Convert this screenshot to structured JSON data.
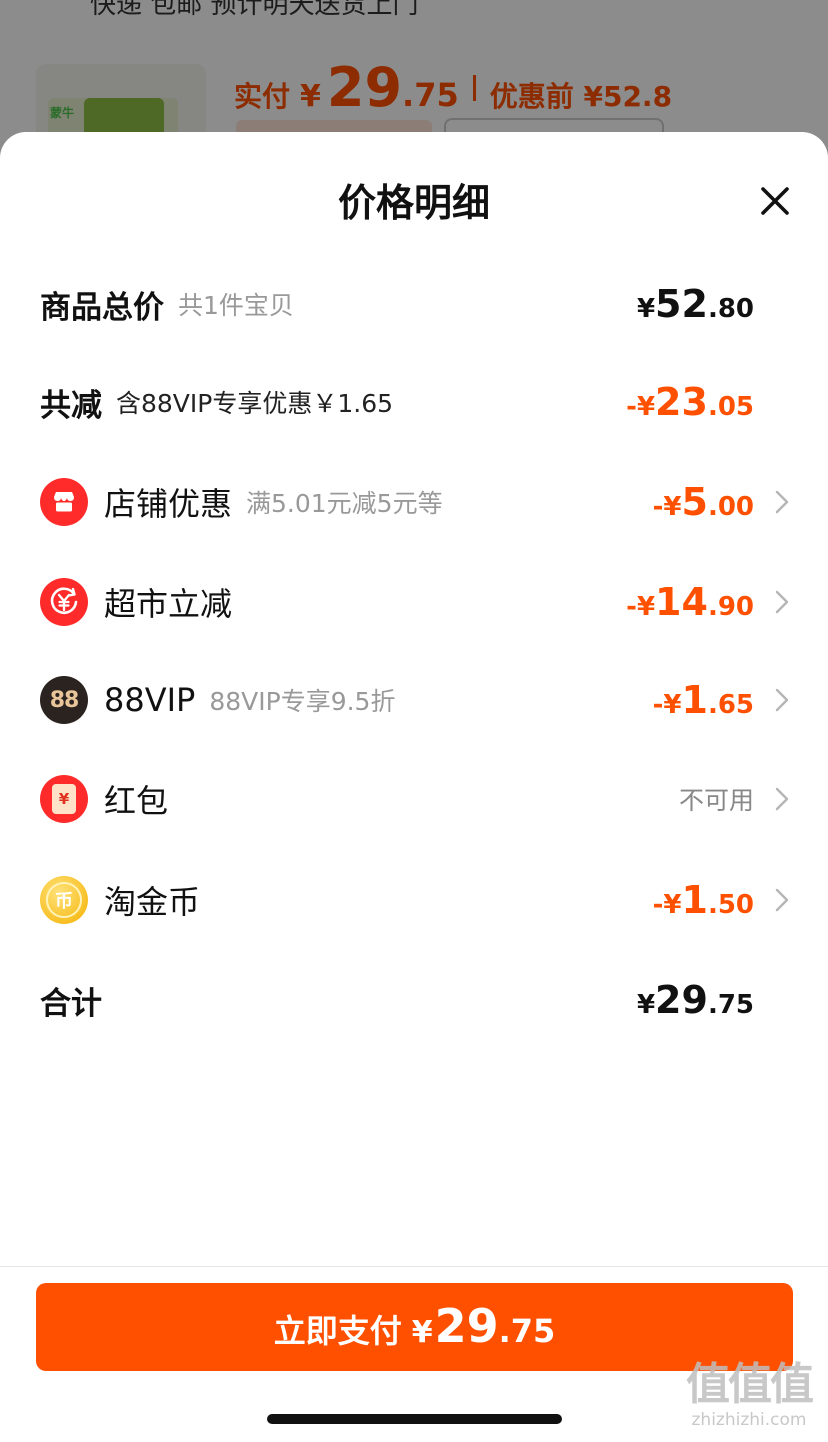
{
  "background": {
    "shipping_text": "快递 包邮 预计明天送货上门",
    "shipping_link": "送货上门",
    "product_brand": "蒙牛",
    "paid_label": "实付",
    "paid_currency": "¥",
    "paid_int": "29",
    "paid_dec": ".75",
    "original_price": "优惠前 ¥52.8"
  },
  "sheet": {
    "title": "价格明细",
    "close_icon": "close-icon"
  },
  "rows": {
    "total": {
      "label": "商品总价",
      "sub": "共1件宝贝",
      "currency": "¥",
      "int": "52",
      "dec": ".80"
    },
    "discount": {
      "label": "共减",
      "sub": "含88VIP专享优惠￥1.65",
      "sign": "-",
      "currency": "¥",
      "int": "23",
      "dec": ".05"
    },
    "shop": {
      "icon": "shop-icon",
      "label": "店铺优惠",
      "sub": "满5.01元减5元等",
      "sign": "-",
      "currency": "¥",
      "int": "5",
      "dec": ".00"
    },
    "supermarket": {
      "icon": "yuan-coin-icon",
      "label": "超市立减",
      "sign": "-",
      "currency": "¥",
      "int": "14",
      "dec": ".90"
    },
    "vip": {
      "icon": "88vip-icon",
      "icon_text": "88",
      "label": "88VIP",
      "sub": "88VIP专享9.5折",
      "sign": "-",
      "currency": "¥",
      "int": "1",
      "dec": ".65"
    },
    "redpacket": {
      "icon": "red-packet-icon",
      "icon_text": "¥",
      "label": "红包",
      "status": "不可用"
    },
    "coins": {
      "icon": "taojin-coin-icon",
      "icon_text": "币",
      "label": "淘金币",
      "sign": "-",
      "currency": "¥",
      "int": "1",
      "dec": ".50"
    },
    "sum": {
      "label": "合计",
      "currency": "¥",
      "int": "29",
      "dec": ".75"
    }
  },
  "pay_button": {
    "label": "立即支付",
    "currency": "¥",
    "int": "29",
    "dec": ".75"
  },
  "watermark": {
    "big": "值值值",
    "small": "zhizhizhi.com"
  },
  "colors": {
    "accent": "#ff5000",
    "sheet": "#ffffff",
    "text": "#111111",
    "muted": "#999999"
  }
}
